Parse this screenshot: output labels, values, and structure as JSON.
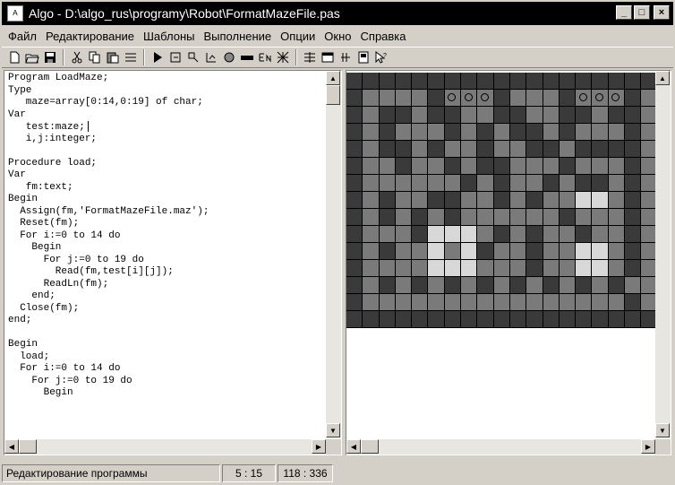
{
  "window": {
    "title": "Algo - D:\\algo_rus\\programy\\Robot\\FormatMazeFile.pas",
    "icon": "app-icon",
    "controls": {
      "minimize": "_",
      "maximize": "□",
      "close": "×"
    }
  },
  "menu": {
    "items": [
      "Файл",
      "Редактирование",
      "Шаблоны",
      "Выполнение",
      "Опции",
      "Окно",
      "Справка"
    ]
  },
  "toolbar": {
    "groups": [
      [
        "new-file-icon",
        "open-file-icon",
        "save-file-icon"
      ],
      [
        "cut-icon",
        "copy-icon",
        "paste-icon",
        "template-icon"
      ],
      [
        "run-icon",
        "step-into-icon",
        "step-over-icon",
        "trace-icon",
        "stop-icon",
        "color-bar-icon",
        "language-icon",
        "grid-icon"
      ],
      [
        "compile-icon",
        "window-icon",
        "split-icon",
        "book-icon",
        "help-cursor-icon"
      ]
    ]
  },
  "editor": {
    "lines": [
      "Program LoadMaze;",
      "Type",
      "   maze=array[0:14,0:19] of char;",
      "Var",
      "   test:maze;",
      "   i,j:integer;",
      "",
      "Procedure load;",
      "Var",
      "   fm:text;",
      "Begin",
      "  Assign(fm,'FormatMazeFile.maz');",
      "  Reset(fm);",
      "  For i:=0 to 14 do",
      "    Begin",
      "      For j:=0 to 19 do",
      "        Read(fm,test[i][j]);",
      "      ReadLn(fm);",
      "    end;",
      "  Close(fm);",
      "end;",
      "",
      "Begin",
      "  load;",
      "  For i:=0 to 14 do",
      "    For j:=0 to 19 do",
      "      Begin"
    ],
    "caret_line": 4
  },
  "maze": {
    "rows": [
      "DDDDDDDDDDDDDDDDDDD",
      "DMMMMDOOODMMMDOOODM",
      "DMDDMDDMMDDMMDDMDDM",
      "DMDMMMDMDMDDMDMMMDM",
      "DMDDMDMMDMMDDMDDDDM",
      "DMMDMMDMDDMMMDMMMDM",
      "DMMMMMMDMDMMDMDDMDM",
      "DMDMMDDMMDMDMMLLMDM",
      "DMDMDMDMMMMMMDMMMDM",
      "DMMMDLLLMDMDMMDMMDM",
      "DMDMMLMLDMMDMMLLMDM",
      "DMMMMLLLMMMDMMLLMDM",
      "DMDMDMDMDMDMDMDMDMM",
      "DMMMMMMMMMMMMMMMMDM",
      "DDDDDDDDDDDDDDDDDDD"
    ],
    "legend": {
      "D": "wall",
      "M": "floor",
      "L": "marked",
      "O": "robot-target"
    }
  },
  "status": {
    "mode": "Редактирование программы",
    "cursor": "5 : 15",
    "size": "118 : 336"
  }
}
